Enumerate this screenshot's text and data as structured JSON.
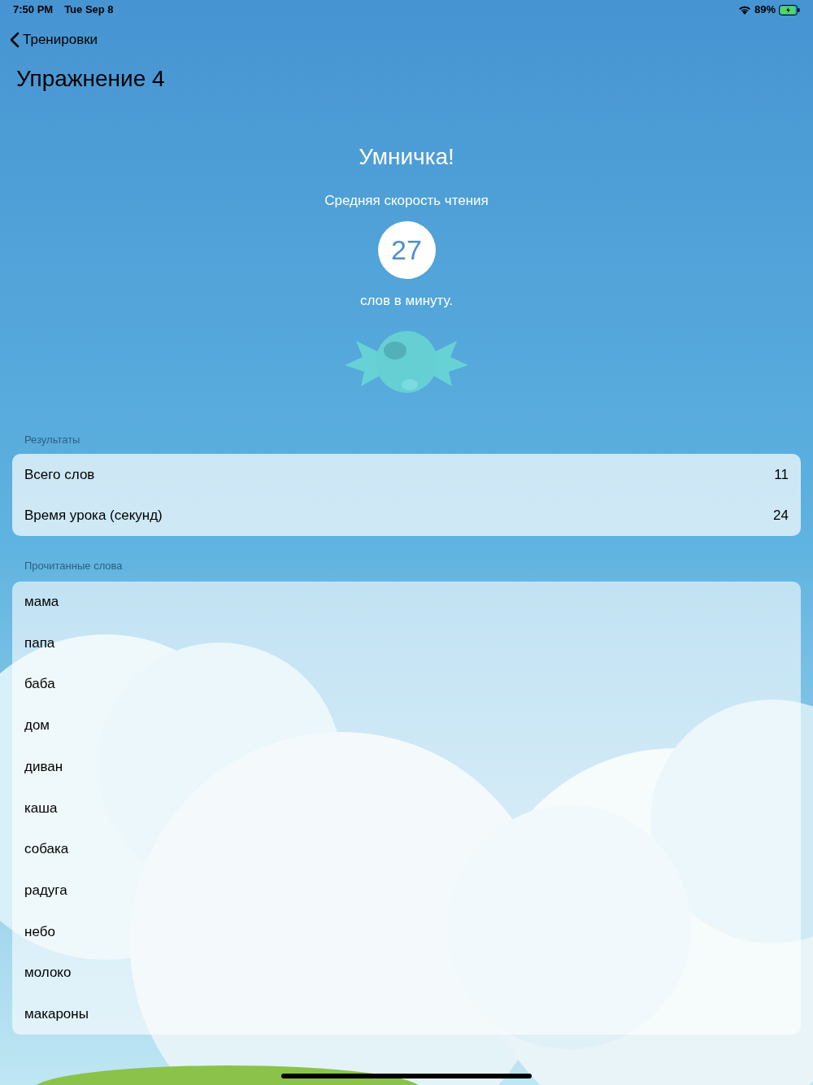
{
  "status_bar": {
    "time": "7:50 PM",
    "date": "Tue Sep 8",
    "battery": "89%"
  },
  "nav": {
    "back": "Тренировки",
    "title": "Упражнение 4"
  },
  "result": {
    "heading": "Умничка!",
    "subtitle": "Средняя скорость чтения",
    "speed": "27",
    "unit": "слов в минуту."
  },
  "results_section": {
    "header": "Результаты",
    "rows": [
      {
        "label": "Всего слов",
        "value": "11"
      },
      {
        "label": "Время урока (секунд)",
        "value": "24"
      }
    ]
  },
  "words_section": {
    "header": "Прочитанные слова",
    "words": [
      "мама",
      "папа",
      "баба",
      "дом",
      "диван",
      "каша",
      "собака",
      "радуга",
      "небо",
      "молоко",
      "макароны"
    ]
  }
}
